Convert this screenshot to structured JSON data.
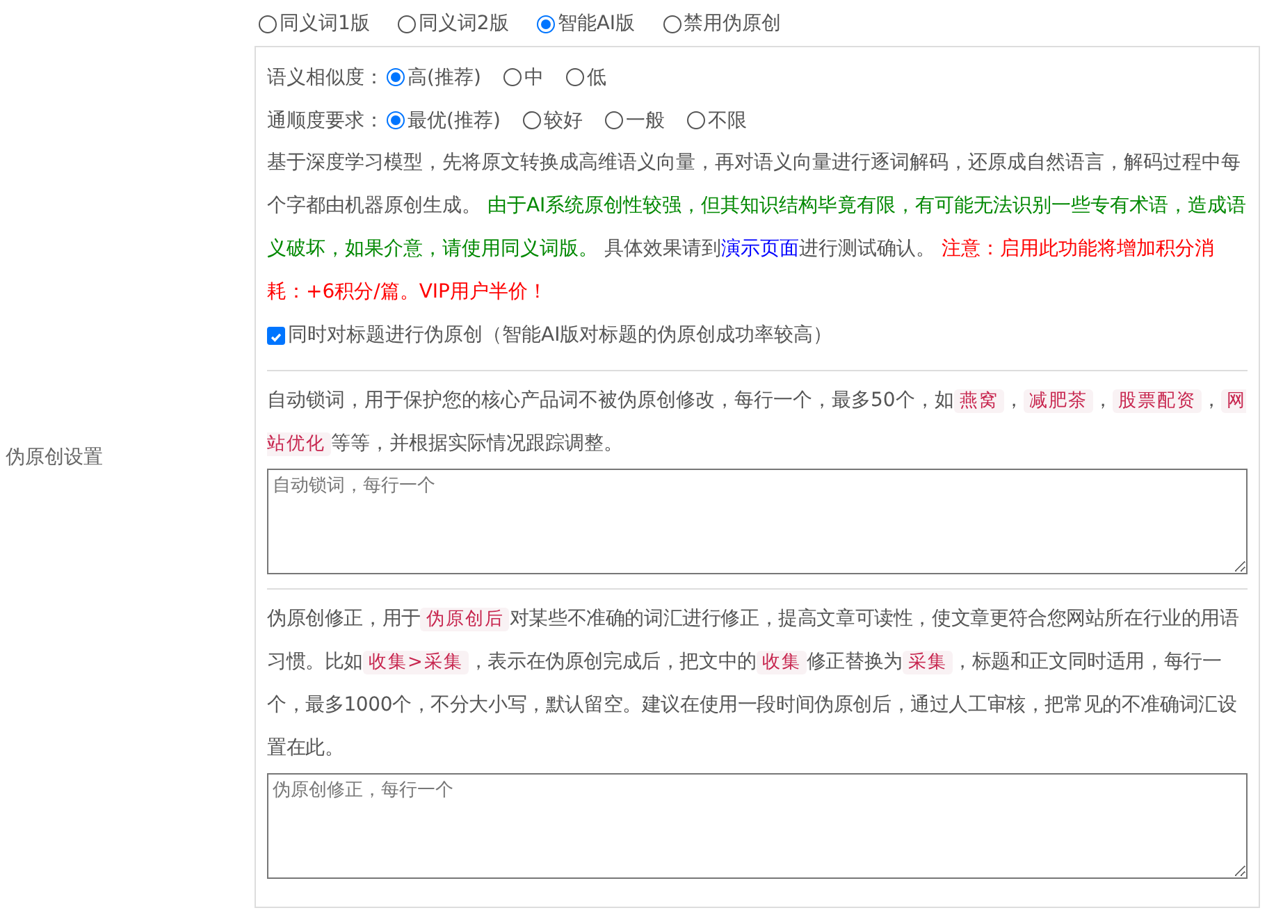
{
  "label": "伪原创设置",
  "modes": [
    {
      "label": "同义词1版",
      "selected": false
    },
    {
      "label": "同义词2版",
      "selected": false
    },
    {
      "label": "智能AI版",
      "selected": true
    },
    {
      "label": "禁用伪原创",
      "selected": false
    }
  ],
  "option_groups": [
    {
      "label": "语义相似度：",
      "options": [
        {
          "label": "高(推荐)",
          "selected": true
        },
        {
          "label": "中",
          "selected": false
        },
        {
          "label": "低",
          "selected": false
        }
      ]
    },
    {
      "label": "通顺度要求：",
      "options": [
        {
          "label": "最优(推荐)",
          "selected": true
        },
        {
          "label": "较好",
          "selected": false
        },
        {
          "label": "一般",
          "selected": false
        },
        {
          "label": "不限",
          "selected": false
        }
      ]
    }
  ],
  "description": [
    {
      "kind": "plain",
      "text": "基于深度学习模型，先将原文转换成高维语义向量，再对语义向量进行逐词解码，还原成自然语言，解码过程中每个字都由机器原创生成。 "
    },
    {
      "kind": "green",
      "text": "由于AI系统原创性较强，但其知识结构毕竟有限，有可能无法识别一些专有术语，造成语义破坏，如果介意，请使用同义词版。"
    },
    {
      "kind": "plain",
      "text": " 具体效果请到"
    },
    {
      "kind": "link",
      "text": "演示页面"
    },
    {
      "kind": "plain",
      "text": "进行测试确认。 "
    },
    {
      "kind": "red",
      "text": "注意：启用此功能将增加积分消耗：+6积分/篇。VIP用户半价！"
    }
  ],
  "title_checkbox": {
    "label": "同时对标题进行伪原创（智能AI版对标题的伪原创成功率较高）",
    "checked": true
  },
  "lock_words": {
    "help": [
      {
        "kind": "plain",
        "text": "自动锁词，用于保护您的核心产品词不被伪原创修改，每行一个，最多50个，如"
      },
      {
        "kind": "code",
        "text": "燕窝"
      },
      {
        "kind": "plain",
        "text": "，"
      },
      {
        "kind": "code",
        "text": "减肥茶"
      },
      {
        "kind": "plain",
        "text": "，"
      },
      {
        "kind": "code",
        "text": "股票配资"
      },
      {
        "kind": "plain",
        "text": "，"
      },
      {
        "kind": "code",
        "text": "网站优化"
      },
      {
        "kind": "plain",
        "text": "等等，并根据实际情况跟踪调整。"
      }
    ],
    "placeholder": "自动锁词，每行一个"
  },
  "corrections": {
    "help": [
      {
        "kind": "plain",
        "text": "伪原创修正，用于"
      },
      {
        "kind": "code",
        "text": "伪原创后"
      },
      {
        "kind": "plain",
        "text": "对某些不准确的词汇进行修正，提高文章可读性，使文章更符合您网站所在行业的用语习惯。比如"
      },
      {
        "kind": "code",
        "text": "收集>采集"
      },
      {
        "kind": "plain",
        "text": "，表示在伪原创完成后，把文中的"
      },
      {
        "kind": "code",
        "text": "收集"
      },
      {
        "kind": "plain",
        "text": "修正替换为"
      },
      {
        "kind": "code",
        "text": "采集"
      },
      {
        "kind": "plain",
        "text": "，标题和正文同时适用，每行一个，最多1000个，不分大小写，默认留空。建议在使用一段时间伪原创后，通过人工审核，把常见的不准确词汇设置在此。"
      }
    ],
    "placeholder": "伪原创修正，每行一个"
  }
}
